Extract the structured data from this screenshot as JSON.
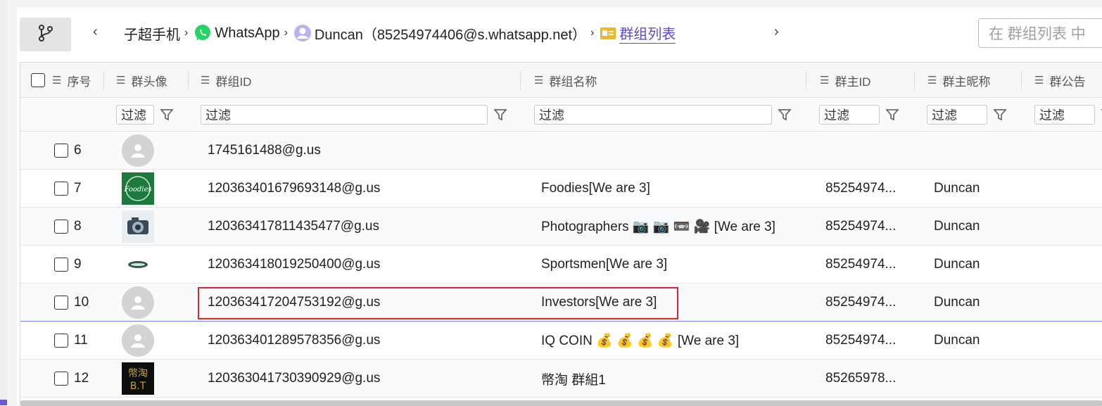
{
  "toolbar": {
    "back": "‹",
    "forward": "›",
    "breadcrumb": [
      {
        "label": "子超手机"
      },
      {
        "label": "WhatsApp"
      },
      {
        "label": "Duncan（85254974406@s.whatsapp.net）"
      },
      {
        "label": "群组列表"
      }
    ],
    "search_placeholder": "在 群组列表 中"
  },
  "grid": {
    "columns": [
      {
        "label": "序号"
      },
      {
        "label": "群头像"
      },
      {
        "label": "群组ID"
      },
      {
        "label": "群组名称"
      },
      {
        "label": "群主ID"
      },
      {
        "label": "群主昵称"
      },
      {
        "label": "群公告"
      }
    ],
    "filter_placeholder": "过滤",
    "rows": [
      {
        "num": "6",
        "avatar": "default",
        "group_id": "1745161488@g.us",
        "name": "",
        "owner_id": "",
        "owner_nick": ""
      },
      {
        "num": "7",
        "avatar": "foodies",
        "group_id": "120363401679693148@g.us",
        "name": "Foodies[We are 3]",
        "owner_id": "85254974...",
        "owner_nick": "Duncan"
      },
      {
        "num": "8",
        "avatar": "camera",
        "group_id": "120363417811435477@g.us",
        "name": "Photographers 📷 📷 📼 🎥 [We are 3]",
        "owner_id": "85254974...",
        "owner_nick": "Duncan"
      },
      {
        "num": "9",
        "avatar": "sports",
        "group_id": "120363418019250400@g.us",
        "name": "Sportsmen[We are 3]",
        "owner_id": "85254974...",
        "owner_nick": "Duncan"
      },
      {
        "num": "10",
        "avatar": "default",
        "group_id": "120363417204753192@g.us",
        "name": "Investors[We are 3]",
        "owner_id": "85254974...",
        "owner_nick": "Duncan"
      },
      {
        "num": "11",
        "avatar": "default",
        "group_id": "120363401289578356@g.us",
        "name": "IQ COIN 💰 💰 💰 💰 [We are 3]",
        "owner_id": "85254974...",
        "owner_nick": "Duncan"
      },
      {
        "num": "12",
        "avatar": "bt",
        "group_id": "120363041730390929@g.us",
        "name": "幣淘 群組1",
        "owner_id": "85265978...",
        "owner_nick": ""
      }
    ]
  },
  "avatars": {
    "foodies_text": "Foodies",
    "bt_text_top": "幣淘",
    "bt_text_bottom": "B.T"
  },
  "colors": {
    "accent": "#5b4bd4",
    "highlight_border": "#d9232d",
    "whatsapp_green": "#25d366"
  },
  "icons": {
    "branch": "git-branch-icon",
    "whatsapp": "whatsapp-icon",
    "user": "user-circle-icon",
    "group_list": "contact-card-icon",
    "filter": "funnel-icon",
    "columns": "list-lines-icon"
  }
}
